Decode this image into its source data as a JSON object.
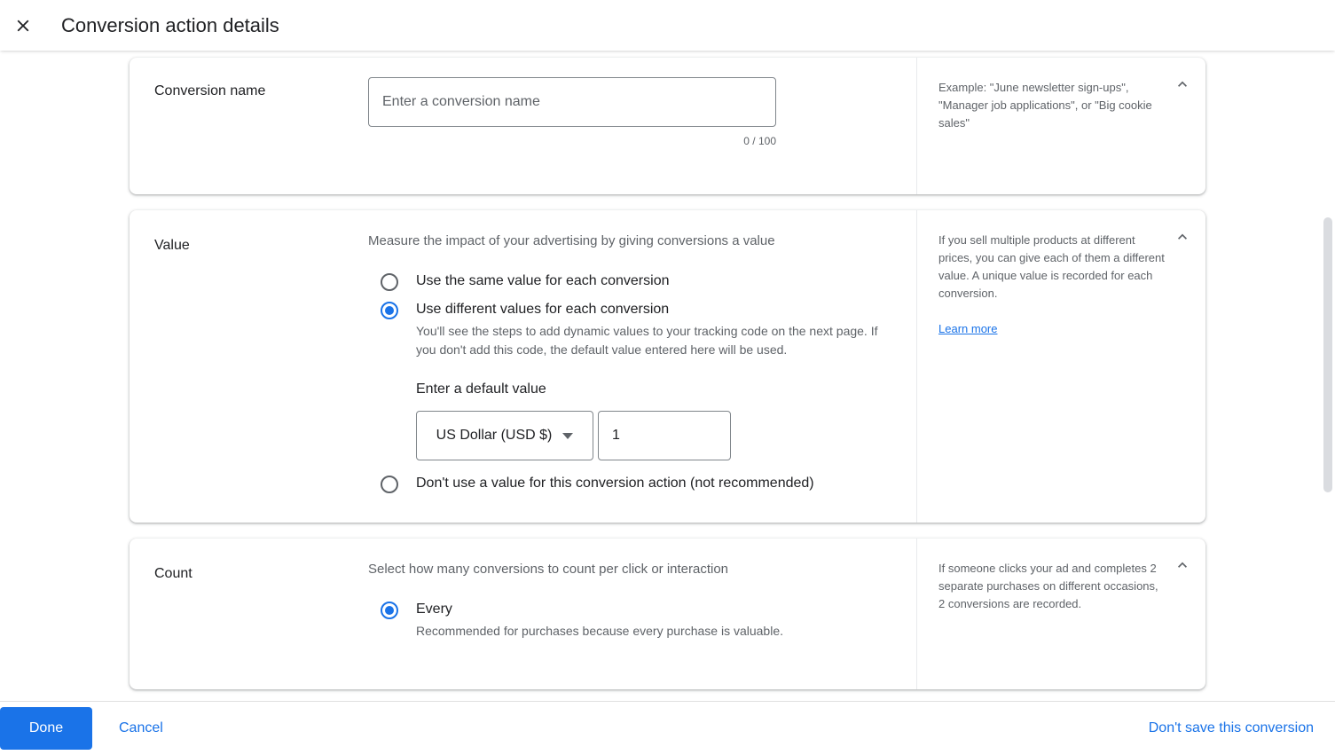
{
  "header": {
    "close_icon": "close-icon",
    "title": "Conversion action details"
  },
  "cards": {
    "conversion_name": {
      "label": "Conversion name",
      "input_placeholder": "Enter a conversion name",
      "input_value": "",
      "char_counter": "0 / 100",
      "help_text": "Example: \"June newsletter sign-ups\", \"Manager job applications\", or \"Big cookie sales\"",
      "collapse_icon": "chevron-up-icon"
    },
    "value": {
      "label": "Value",
      "description": "Measure the impact of your advertising by giving conversions a value",
      "options": [
        {
          "label": "Use the same value for each conversion",
          "sub": "",
          "selected": false
        },
        {
          "label": "Use different values for each conversion",
          "sub": "You'll see the steps to add dynamic values to your tracking code on the next page. If you don't add this code, the default value entered here will be used.",
          "selected": true
        },
        {
          "label": "Don't use a value for this conversion action (not recommended)",
          "sub": "",
          "selected": false
        }
      ],
      "default_value_label": "Enter a default value",
      "currency": "US Dollar (USD $)",
      "currency_caret_icon": "caret-down-icon",
      "amount": "1",
      "help_text": "If you sell multiple products at different prices, you can give each of them a different value. A unique value is recorded for each conversion.",
      "help_link": "Learn more",
      "collapse_icon": "chevron-up-icon"
    },
    "count": {
      "label": "Count",
      "description": "Select how many conversions to count per click or interaction",
      "options": [
        {
          "label": "Every",
          "sub": "Recommended for purchases because every purchase is valuable.",
          "selected": true
        }
      ],
      "help_text": "If someone clicks your ad and completes 2 separate purchases on different occasions, 2 conversions are recorded.",
      "collapse_icon": "chevron-up-icon"
    }
  },
  "footer": {
    "done_label": "Done",
    "cancel_label": "Cancel",
    "dont_save_label": "Don't save this conversion"
  },
  "colors": {
    "accent": "#1a73e8",
    "text_primary": "#202124",
    "text_secondary": "#5f6368",
    "border": "#dadce0"
  }
}
